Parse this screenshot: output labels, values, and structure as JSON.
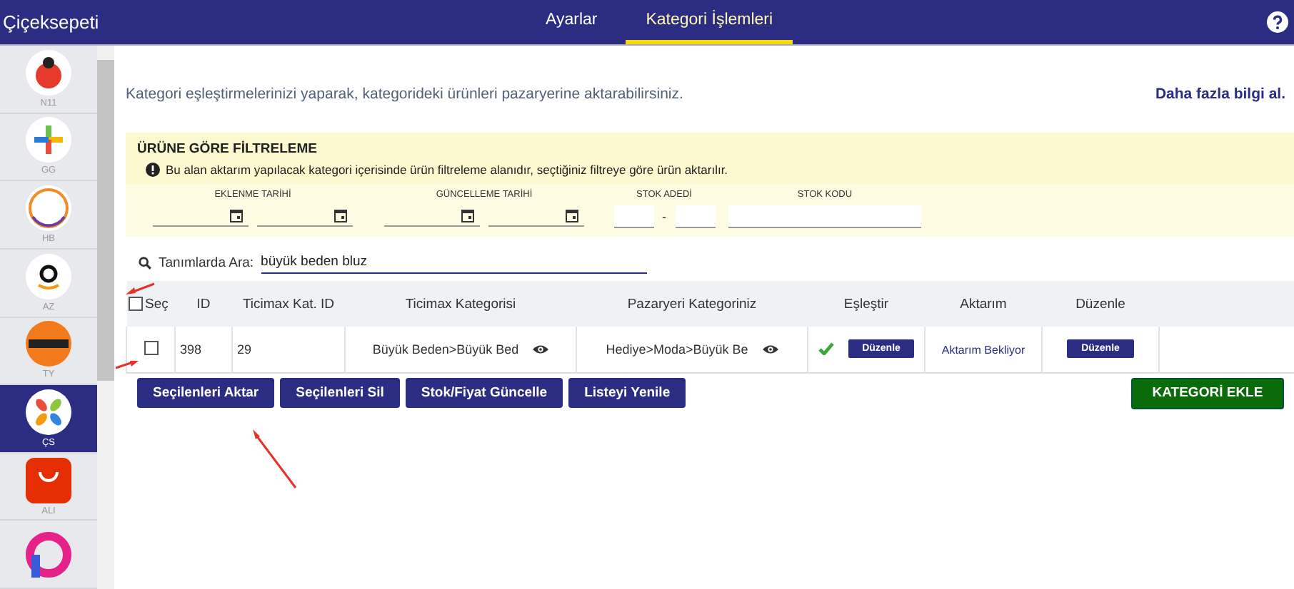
{
  "app": {
    "title": "Çiçeksepeti"
  },
  "tabs": [
    {
      "label": "Ayarlar",
      "selected": false
    },
    {
      "label": "Kategori İşlemleri",
      "selected": true
    }
  ],
  "sidebar": {
    "items": [
      {
        "label": "N11",
        "selected": false
      },
      {
        "label": "GG",
        "selected": false
      },
      {
        "label": "HB",
        "selected": false
      },
      {
        "label": "AZ",
        "selected": false
      },
      {
        "label": "TY",
        "selected": false
      },
      {
        "label": "ÇS",
        "selected": true
      },
      {
        "label": "ALI",
        "selected": false
      },
      {
        "selected": false
      }
    ]
  },
  "intro": {
    "text": "Kategori eşleştirmelerinizi yaparak, kategorideki ürünleri pazaryerine aktarabilirsiniz.",
    "link": "Daha fazla bilgi al."
  },
  "filter": {
    "title": "ÜRÜNE GÖRE FİLTRELEME",
    "info": "Bu alan aktarım yapılacak kategori içerisinde ürün filtreleme alanıdır, seçtiğiniz filtreye göre ürün aktarılır.",
    "fields": [
      {
        "label": "EKLENME TARİHİ",
        "kind": "date-range"
      },
      {
        "label": "GÜNCELLEME TARİHİ",
        "kind": "date-range"
      },
      {
        "label": "STOK ADEDİ",
        "kind": "number-range",
        "separator": "-"
      },
      {
        "label": "STOK KODU",
        "kind": "text"
      }
    ]
  },
  "search": {
    "label": "Tanımlarda Ara:",
    "value": "büyük beden bluz"
  },
  "table": {
    "select_all_checked": false,
    "columns": [
      "Seç",
      "ID",
      "Ticimax Kat. ID",
      "Ticimax Kategorisi",
      "Pazaryeri Kategoriniz",
      "Eşleştir",
      "Aktarım",
      "Düzenle"
    ],
    "rows": [
      {
        "checked": false,
        "id": "398",
        "ticimax_id": "29",
        "ticimax_category": "Büyük Beden>Büyük Bed",
        "marketplace_category": "Hediye>Moda>Büyük Be",
        "matched": true,
        "match_button": "Düzenle",
        "transfer_status": "Aktarım Bekliyor",
        "edit_button": "Düzenle"
      }
    ]
  },
  "actions": [
    "Seçilenleri Aktar",
    "Seçilenleri Sil",
    "Stok/Fiyat Güncelle",
    "Listeyi Yenile"
  ],
  "add_button": "KATEGORİ EKLE"
}
